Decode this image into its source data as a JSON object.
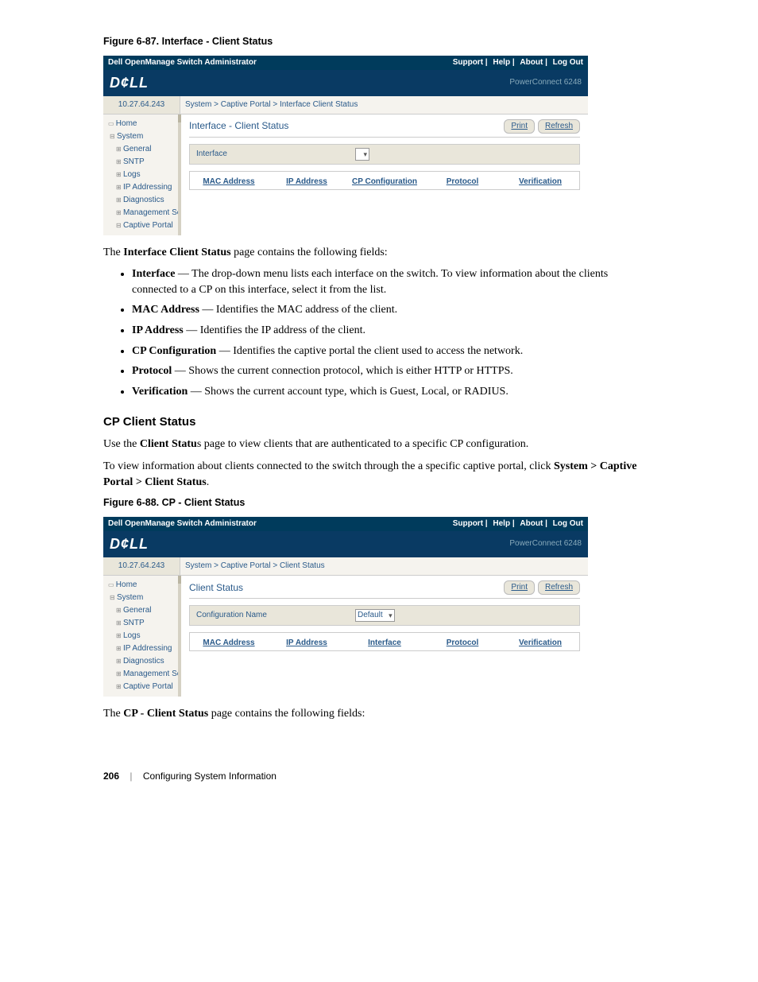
{
  "figure1": {
    "caption": "Figure 6-87.    Interface - Client Status",
    "titlebar": "Dell OpenManage Switch Administrator",
    "links": {
      "support": "Support",
      "help": "Help",
      "about": "About",
      "logout": "Log Out"
    },
    "logo": "D¢LL",
    "model": "PowerConnect 6248",
    "ip": "10.27.64.243",
    "breadcrumb": "System > Captive Portal > Interface Client Status",
    "tree": [
      "Home",
      "System",
      "General",
      "SNTP",
      "Logs",
      "IP Addressing",
      "Diagnostics",
      "Management Secur",
      "Captive Portal"
    ],
    "panelTitle": "Interface - Client Status",
    "btnPrint": "Print",
    "btnRefresh": "Refresh",
    "fieldLabel": "Interface",
    "selectValue": "",
    "cols": [
      "MAC Address",
      "IP Address",
      "CP Configuration",
      "Protocol",
      "Verification"
    ]
  },
  "para1_a": "The ",
  "para1_b": "Interface Client Status",
  "para1_c": " page contains the following fields:",
  "bullets1": [
    {
      "term": "Interface",
      "desc": " — The drop-down menu lists each interface on the switch. To view information about the clients connected to a CP on this interface, select it from the list."
    },
    {
      "term": "MAC Address",
      "desc": " — Identifies the MAC address of the client."
    },
    {
      "term": "IP Address",
      "desc": " — Identifies the IP address of the client."
    },
    {
      "term": "CP Configuration",
      "desc": " — Identifies the captive portal the client used to access the network."
    },
    {
      "term": "Protocol",
      "desc": " — Shows the current connection protocol, which is either HTTP or HTTPS."
    },
    {
      "term": "Verification",
      "desc": " — Shows the current account type, which is Guest, Local, or RADIUS."
    }
  ],
  "sectionHead": "CP Client Status",
  "para2_a": "Use the ",
  "para2_b": "Client Statu",
  "para2_c": "s page to view clients that are authenticated to a specific CP configuration.",
  "para3_a": "To view information about clients connected to the switch through the a specific captive portal, click ",
  "para3_b": "System > Captive Portal > Client Status",
  "para3_c": ".",
  "figure2": {
    "caption": "Figure 6-88.    CP - Client Status",
    "titlebar": "Dell OpenManage Switch Administrator",
    "links": {
      "support": "Support",
      "help": "Help",
      "about": "About",
      "logout": "Log Out"
    },
    "logo": "D¢LL",
    "model": "PowerConnect 6248",
    "ip": "10.27.64.243",
    "breadcrumb": "System > Captive Portal > Client Status",
    "tree": [
      "Home",
      "System",
      "General",
      "SNTP",
      "Logs",
      "IP Addressing",
      "Diagnostics",
      "Management Secur",
      "Captive Portal"
    ],
    "panelTitle": "Client Status",
    "btnPrint": "Print",
    "btnRefresh": "Refresh",
    "fieldLabel": "Configuration Name",
    "selectValue": "Default",
    "cols": [
      "MAC Address",
      "IP Address",
      "Interface",
      "Protocol",
      "Verification"
    ]
  },
  "para4_a": "The ",
  "para4_b": "CP - Client Status",
  "para4_c": " page contains the following fields:",
  "footer": {
    "page": "206",
    "section": "Configuring System Information"
  }
}
